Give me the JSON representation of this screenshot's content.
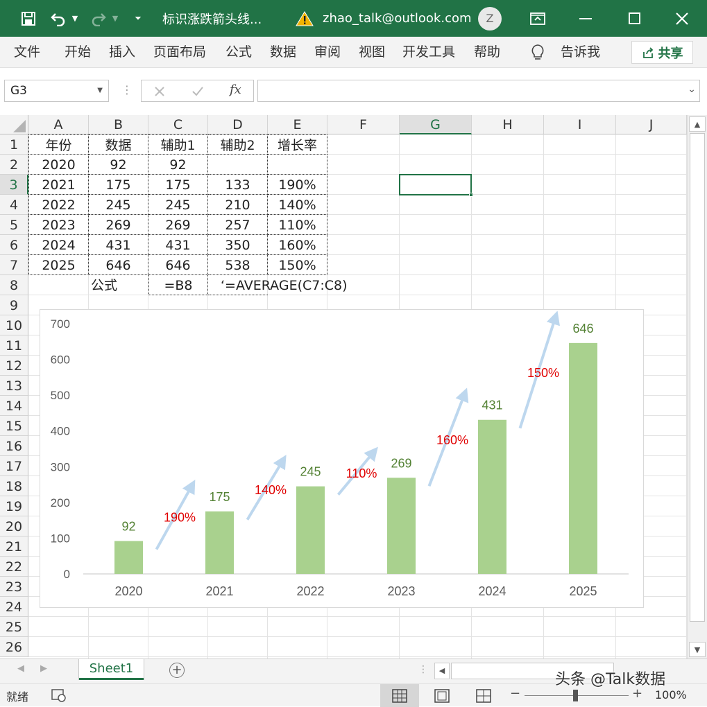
{
  "titlebar": {
    "filename": "标识涨跌箭头线...",
    "account": "zhao_talk@outlook.com",
    "avatar_letter": "Z"
  },
  "ribbon": {
    "tabs": [
      "文件",
      "开始",
      "插入",
      "页面布局",
      "公式",
      "数据",
      "审阅",
      "视图",
      "开发工具",
      "帮助"
    ],
    "tellme": "告诉我",
    "share": "共享"
  },
  "formula_bar": {
    "name_box": "G3",
    "fx": "fx",
    "formula": ""
  },
  "sheet": {
    "columns": [
      "A",
      "B",
      "C",
      "D",
      "E",
      "F",
      "G",
      "H",
      "I",
      "J"
    ],
    "rows": [
      "1",
      "2",
      "3",
      "4",
      "5",
      "6",
      "7",
      "8",
      "9",
      "10",
      "11",
      "12",
      "13",
      "14",
      "15",
      "16",
      "17",
      "18",
      "19",
      "20",
      "21",
      "22",
      "23",
      "24",
      "25",
      "26"
    ],
    "headers": [
      "年份",
      "数据",
      "辅助1",
      "辅助2",
      "增长率"
    ],
    "table": [
      [
        "2020",
        "92",
        "92",
        "",
        ""
      ],
      [
        "2021",
        "175",
        "175",
        "133",
        "190%"
      ],
      [
        "2022",
        "245",
        "245",
        "210",
        "140%"
      ],
      [
        "2023",
        "269",
        "269",
        "257",
        "110%"
      ],
      [
        "2024",
        "431",
        "431",
        "350",
        "160%"
      ],
      [
        "2025",
        "646",
        "646",
        "538",
        "150%"
      ]
    ],
    "row8": {
      "b": "公式",
      "c": "=B8",
      "d": "‘=AVERAGE(C7:C8)"
    },
    "selected_cell": "G3"
  },
  "chart_data": {
    "type": "bar",
    "categories": [
      "2020",
      "2021",
      "2022",
      "2023",
      "2024",
      "2025"
    ],
    "values": [
      92,
      175,
      245,
      269,
      431,
      646
    ],
    "growth_labels": [
      "190%",
      "140%",
      "110%",
      "160%",
      "150%"
    ],
    "ylim": [
      0,
      700
    ],
    "yticks": [
      "0",
      "100",
      "200",
      "300",
      "400",
      "500",
      "600",
      "700"
    ],
    "title": "",
    "xlabel": "",
    "ylabel": "",
    "grid": false,
    "colors": {
      "bar": "#a9d18e",
      "bar_label": "#548235",
      "growth_label": "#e00000",
      "arrow": "#bdd7ee"
    }
  },
  "tabs": {
    "sheet1": "Sheet1"
  },
  "status": {
    "ready": "就绪",
    "zoom": "100%"
  },
  "watermark": "头条 @Talk数据"
}
